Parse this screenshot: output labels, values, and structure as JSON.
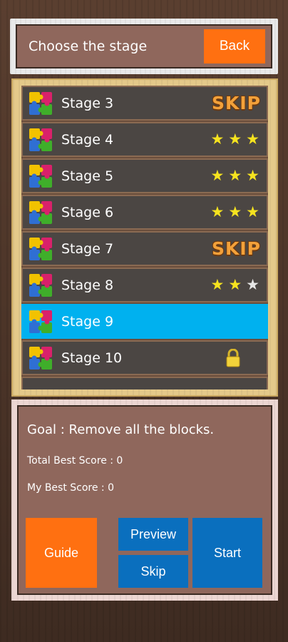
{
  "header": {
    "title": "Choose the stage",
    "back_label": "Back"
  },
  "stages": [
    {
      "label": "Stage 3",
      "status": "skip",
      "badge": "SKIP"
    },
    {
      "label": "Stage 4",
      "status": "stars",
      "stars": 3
    },
    {
      "label": "Stage 5",
      "status": "stars",
      "stars": 3
    },
    {
      "label": "Stage 6",
      "status": "stars",
      "stars": 3
    },
    {
      "label": "Stage 7",
      "status": "skip",
      "badge": "SKIP"
    },
    {
      "label": "Stage 8",
      "status": "stars",
      "stars": 2
    },
    {
      "label": "Stage 9",
      "status": "selected"
    },
    {
      "label": "Stage 10",
      "status": "locked"
    }
  ],
  "info": {
    "goal": "Goal : Remove all the blocks.",
    "total_best": "Total Best Score : 0",
    "my_best": "My Best Score : 0"
  },
  "buttons": {
    "guide": "Guide",
    "preview": "Preview",
    "skip": "Skip",
    "start": "Start"
  },
  "colors": {
    "accent_orange": "#ff7011",
    "accent_blue": "#0a6fbe",
    "selected_row": "#00b1ef",
    "star": "#f6e31f"
  },
  "icons": {
    "stage": "puzzle-icon",
    "locked": "lock-icon",
    "rating": "star-icon"
  }
}
